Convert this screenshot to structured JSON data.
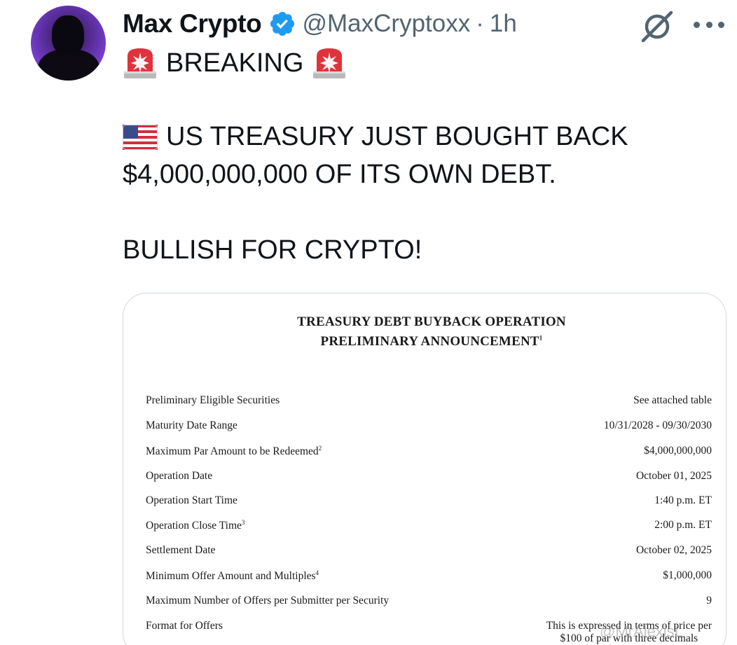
{
  "post": {
    "author_name": "Max Crypto",
    "handle": "@MaxCryptoxx",
    "separator": "·",
    "time": "1h",
    "line1": "BREAKING",
    "line2": "US TREASURY JUST BOUGHT BACK",
    "line3": "$4,000,000,000 OF ITS OWN DEBT.",
    "line4": "BULLISH FOR CRYPTO!",
    "icons": {
      "verified": "verified-badge-icon",
      "grok": "grok-icon",
      "more": "more-options-icon",
      "siren": "police-light-emoji",
      "flag": "us-flag-emoji"
    },
    "colors": {
      "verified": "#1d9bf0",
      "muted_text": "#536471",
      "text": "#0f1419"
    }
  },
  "document": {
    "title1": "TREASURY DEBT BUYBACK OPERATION",
    "title2": "PRELIMINARY ANNOUNCEMENT",
    "title2_sup": "1",
    "rows": [
      {
        "label": "Preliminary Eligible Securities",
        "sup": "",
        "value": "See attached table"
      },
      {
        "label": "Maturity Date Range",
        "sup": "",
        "value": "10/31/2028 - 09/30/2030"
      },
      {
        "label": "Maximum Par Amount to be Redeemed",
        "sup": "2",
        "value": "$4,000,000,000"
      },
      {
        "label": "Operation Date",
        "sup": "",
        "value": "October 01, 2025"
      },
      {
        "label": "Operation Start Time",
        "sup": "",
        "value": "1:40 p.m. ET"
      },
      {
        "label": "Operation Close Time",
        "sup": "3",
        "value": "2:00 p.m. ET"
      },
      {
        "label": "Settlement Date",
        "sup": "",
        "value": "October 02, 2025"
      },
      {
        "label": "Minimum Offer Amount and Multiples",
        "sup": "4",
        "value": "$1,000,000"
      },
      {
        "label": "Maximum Number of Offers per Submitter per Security",
        "sup": "",
        "value": "9"
      },
      {
        "label": "Format for Offers",
        "sup": "",
        "value": "This is expressed in terms of price per",
        "value2": "$100 of par with three decimals"
      }
    ],
    "watermark": "@MrAlexisL"
  }
}
